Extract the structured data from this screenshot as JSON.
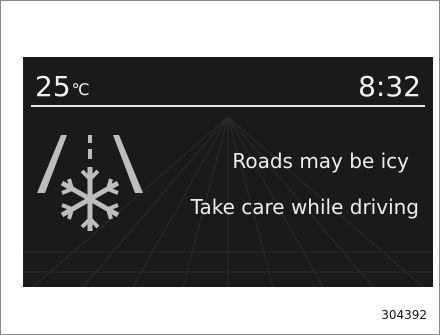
{
  "display": {
    "temperature_value": "25",
    "temperature_unit": "℃",
    "time": "8:32",
    "message_line1": "Roads may be icy",
    "message_line2": "Take care while driving"
  },
  "icon": {
    "name": "icy-road-icon"
  },
  "figure_ref": "304392",
  "colors": {
    "screen_background": "#1a1a1a",
    "text": "#f2f2f2",
    "icon": "#bdbdbd"
  }
}
